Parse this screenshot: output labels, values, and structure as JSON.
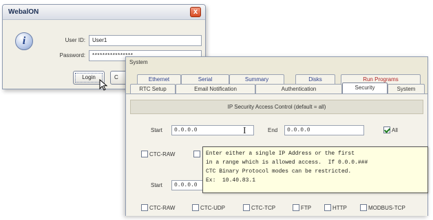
{
  "login": {
    "title": "WebalON",
    "close_label": "x",
    "user_id_label": "User ID:",
    "user_id_value": "User1",
    "password_label": "Password:",
    "password_value": "****************",
    "login_label": "Login",
    "cancel_label": "C"
  },
  "system": {
    "title": "System",
    "tabs_row1": [
      "Ethernet",
      "Serial",
      "Summary",
      "Disks",
      "Run Programs"
    ],
    "tabs_row2": [
      "RTC Setup",
      "Email Notification",
      "Authentication",
      "Security",
      "System"
    ],
    "active_tab": "Security",
    "section_header": "IP Security Access Control (default = all)",
    "start_label": "Start",
    "start_value": "0.0.0.0",
    "end_label": "End",
    "end_value": "0.0.0.0",
    "all_label": "All",
    "row1_checkboxes": [
      "CTC-RAW",
      ""
    ],
    "start2_label": "Start",
    "start2_value": "0.0.0.0",
    "row2_checkboxes": [
      "CTC-RAW",
      "CTC-UDP",
      "CTC-TCP",
      "FTP",
      "HTTP",
      "MODBUS-TCP"
    ],
    "tooltip": {
      "line1": "Enter either a single IP Address or the first",
      "line2": "in a range which is allowed access.  If 0.0.0.###",
      "line3": "CTC Binary Protocol modes can be restricted.",
      "line4": "Ex:  10.40.83.1"
    }
  },
  "colors": {
    "tooltip_bg": "#ffffe1",
    "close_button": "#d84a22",
    "run_programs_tab": "#b02424",
    "checkmark": "#1a7a1a"
  }
}
